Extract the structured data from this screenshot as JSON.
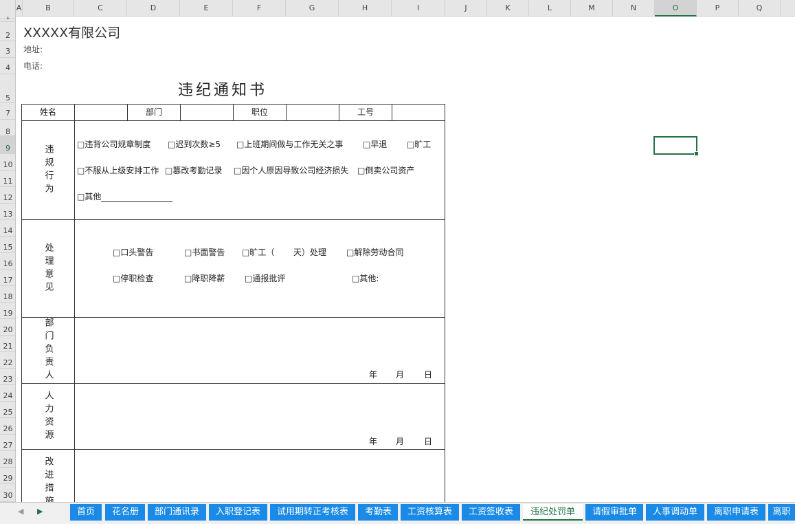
{
  "columns": [
    "A",
    "B",
    "C",
    "D",
    "E",
    "F",
    "G",
    "H",
    "I",
    "J",
    "K",
    "L",
    "M",
    "N",
    "O",
    "P",
    "Q"
  ],
  "active_column": "O",
  "rows": [
    "1",
    "2",
    "3",
    "4",
    "5",
    "7",
    "8",
    "9",
    "10",
    "11",
    "12",
    "13",
    "14",
    "15",
    "16",
    "17",
    "18",
    "19",
    "20",
    "21",
    "22",
    "23",
    "24",
    "25",
    "26",
    "27",
    "28",
    "29",
    "30"
  ],
  "active_row": "9",
  "sheet": {
    "company": "XXXXX有限公司",
    "address_label": "地址:",
    "phone_label": "电话:",
    "title": "违纪通知书",
    "header": {
      "name": "姓名",
      "dept": "部门",
      "position": "职位",
      "id": "工号"
    },
    "violation": {
      "label": "违规行为",
      "options_row1": [
        "□违背公司规章制度",
        "□迟到次数≥5",
        "□上班期间做与工作无关之事",
        "□早退",
        "□旷工"
      ],
      "options_row2": [
        "□不服从上级安排工作",
        "□篡改考勤记录",
        "□因个人原因导致公司经济损失",
        "□倒卖公司资产"
      ],
      "other": "□其他"
    },
    "handling": {
      "label": "处理意见",
      "options_row1": [
        "□口头警告",
        "□书面警告",
        "□旷工（",
        "天）处理",
        "□解除劳动合同"
      ],
      "options_row2": [
        "□停职检查",
        "□降职降薪",
        "□通报批评",
        "□其他:"
      ]
    },
    "dept_head": {
      "label": "部门负责人",
      "year": "年",
      "month": "月",
      "day": "日"
    },
    "hr": {
      "label": "人力资源",
      "year": "年",
      "month": "月",
      "day": "日"
    },
    "improve": {
      "label": "改进措施"
    }
  },
  "tabs": [
    "首页",
    "花名册",
    "部门通讯录",
    "入职登记表",
    "试用期转正考核表",
    "考勤表",
    "工资核算表",
    "工资签收表",
    "违纪处罚单",
    "请假审批单",
    "人事调动单",
    "离职申请表",
    "离职"
  ],
  "active_tab": "违纪处罚单",
  "colors": {
    "tab_blue": "#1a8ae6",
    "excel_green": "#217346"
  }
}
